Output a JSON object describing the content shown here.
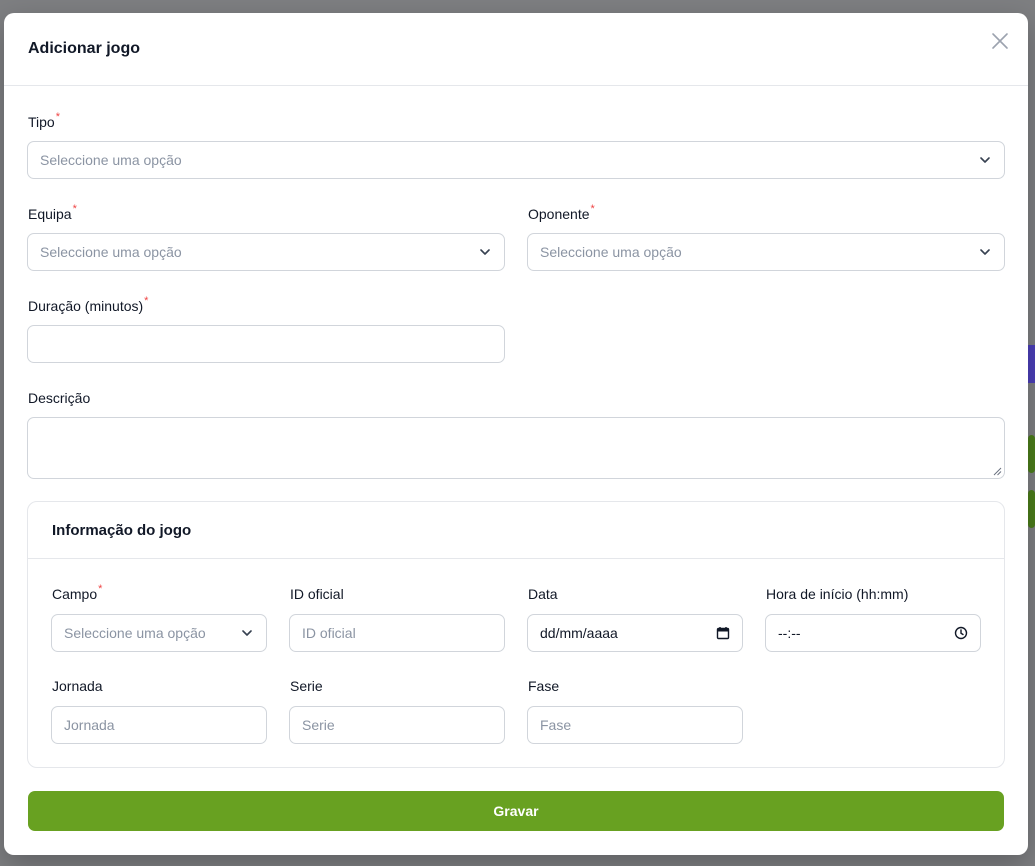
{
  "modal": {
    "title": "Adicionar jogo",
    "close_icon": "close-icon"
  },
  "form": {
    "tipo": {
      "label": "Tipo",
      "required_mark": "*",
      "placeholder": "Seleccione uma opção"
    },
    "equipa": {
      "label": "Equipa",
      "required_mark": "*",
      "placeholder": "Seleccione uma opção"
    },
    "oponente": {
      "label": "Oponente",
      "required_mark": "*",
      "placeholder": "Seleccione uma opção"
    },
    "duracao": {
      "label": "Duração (minutos)",
      "required_mark": "*",
      "value": ""
    },
    "descricao": {
      "label": "Descrição",
      "value": ""
    }
  },
  "game_info": {
    "title": "Informação do jogo",
    "campo": {
      "label": "Campo",
      "required_mark": "*",
      "placeholder": "Seleccione uma opção"
    },
    "id_oficial": {
      "label": "ID oficial",
      "placeholder": "ID oficial"
    },
    "data": {
      "label": "Data",
      "value": "dd/mm/aaaa",
      "icon": "calendar-icon"
    },
    "hora": {
      "label": "Hora de início (hh:mm)",
      "value": "--:--",
      "icon": "clock-icon"
    },
    "jornada": {
      "label": "Jornada",
      "placeholder": "Jornada"
    },
    "serie": {
      "label": "Serie",
      "placeholder": "Serie"
    },
    "fase": {
      "label": "Fase",
      "placeholder": "Fase"
    }
  },
  "actions": {
    "submit_label": "Gravar"
  },
  "colors": {
    "primary": "#68a121",
    "required": "#ef4444",
    "border": "#d1d5db"
  }
}
